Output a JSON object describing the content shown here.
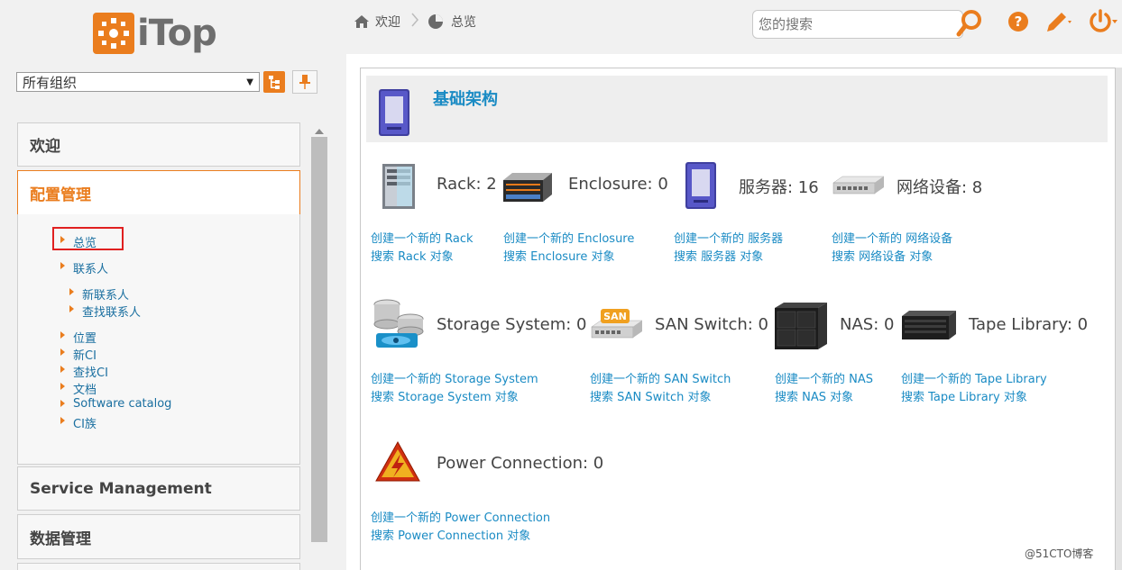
{
  "app": {
    "logo_text": "iTop",
    "organization": {
      "selected": "所有组织"
    }
  },
  "breadcrumb": [
    {
      "label": "欢迎",
      "icon": "home-icon"
    },
    {
      "label": "总览",
      "icon": "pie-chart-icon"
    }
  ],
  "search": {
    "placeholder": "您的搜索",
    "value": ""
  },
  "toolbar": {
    "icons": [
      "search-icon",
      "help-icon",
      "pencil-icon",
      "power-icon"
    ]
  },
  "sidebar": {
    "sections": [
      {
        "label": "欢迎",
        "active": false
      },
      {
        "label": "配置管理",
        "active": true
      },
      {
        "label": "Service Management",
        "active": false
      },
      {
        "label": "数据管理",
        "active": false
      }
    ],
    "config_items": [
      "总览",
      "联系人",
      "新联系人",
      "查找联系人",
      "位置",
      "新CI",
      "查找CI",
      "文档",
      "Software catalog",
      "CI族"
    ]
  },
  "main": {
    "section_title": "基础架构",
    "tiles": [
      {
        "name": "Rack",
        "count_label": "Rack: 2",
        "create": "创建一个新的 Rack",
        "search": "搜索 Rack 对象",
        "icon": "rack-icon"
      },
      {
        "name": "Enclosure",
        "count_label": "Enclosure: 0",
        "create": "创建一个新的 Enclosure",
        "search": "搜索 Enclosure 对象",
        "icon": "enclosure-icon"
      },
      {
        "name": "服务器",
        "count_label": "服务器: 16",
        "create": "创建一个新的 服务器",
        "search": "搜索 服务器 对象",
        "icon": "server-icon"
      },
      {
        "name": "网络设备",
        "count_label": "网络设备: 8",
        "create": "创建一个新的 网络设备",
        "search": "搜索 网络设备 对象",
        "icon": "network-device-icon"
      },
      {
        "name": "Storage System",
        "count_label": "Storage System: 0",
        "create": "创建一个新的 Storage System",
        "search": "搜索 Storage System 对象",
        "icon": "storage-system-icon"
      },
      {
        "name": "SAN Switch",
        "count_label": "SAN Switch: 0",
        "create": "创建一个新的 SAN Switch",
        "search": "搜索 SAN Switch 对象",
        "icon": "san-switch-icon"
      },
      {
        "name": "NAS",
        "count_label": "NAS: 0",
        "create": "创建一个新的 NAS",
        "search": "搜索 NAS 对象",
        "icon": "nas-icon"
      },
      {
        "name": "Tape Library",
        "count_label": "Tape Library: 0",
        "create": "创建一个新的 Tape Library",
        "search": "搜索 Tape Library 对象",
        "icon": "tape-library-icon"
      },
      {
        "name": "Power Connection",
        "count_label": "Power Connection: 0",
        "create": "创建一个新的 Power Connection",
        "search": "搜索 Power Connection 对象",
        "icon": "power-connection-icon"
      }
    ]
  },
  "watermark": "@51CTO博客",
  "colors": {
    "accent": "#ea7d1e",
    "link": "#1a8bc4",
    "highlight_box": "#e02020"
  }
}
